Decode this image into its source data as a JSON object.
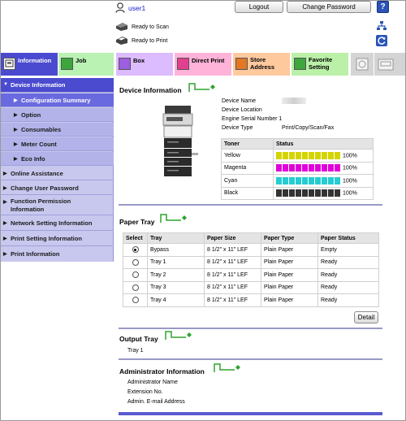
{
  "header": {
    "user": "user1",
    "logout": "Logout",
    "change_password": "Change Password",
    "help": "?",
    "status_scan": "Ready to Scan",
    "status_print": "Ready to Print"
  },
  "tabs": [
    {
      "label": "Information",
      "icon": "info-icon",
      "color": "#4a4ad0"
    },
    {
      "label": "Job",
      "icon": "job-icon",
      "color": "#b9f2b2"
    },
    {
      "label": "Box",
      "icon": "box-icon",
      "color": "#ddbbff"
    },
    {
      "label": "Direct Print",
      "icon": "direct-print-icon",
      "color": "#ffb3d9"
    },
    {
      "label": "Store\nAddress",
      "icon": "store-address-icon",
      "color": "#ffc99e"
    },
    {
      "label": "Favorite\nSetting",
      "icon": "favorite-icon",
      "color": "#bbf0a8"
    }
  ],
  "sidebar": {
    "items": [
      {
        "label": "Device Information"
      },
      {
        "label": "Configuration Summary"
      },
      {
        "label": "Option"
      },
      {
        "label": "Consumables"
      },
      {
        "label": "Meter Count"
      },
      {
        "label": "Eco Info"
      },
      {
        "label": "Online Assistance"
      },
      {
        "label": "Change User Password"
      },
      {
        "label": "Function Permission\nInformation"
      },
      {
        "label": "Network Setting Information"
      },
      {
        "label": "Print Setting Information"
      },
      {
        "label": "Print Information"
      }
    ]
  },
  "device": {
    "title": "Device Information",
    "name_label": "Device Name",
    "location_label": "Device Location",
    "serial_label": "Engine Serial Number 1",
    "type_label": "Device Type",
    "type_value": "Print/Copy/Scan/Fax"
  },
  "toner": {
    "col_toner": "Toner",
    "col_status": "Status",
    "rows": [
      {
        "name": "Yellow",
        "level": "100%",
        "color": "#d4d400"
      },
      {
        "name": "Magenta",
        "level": "100%",
        "color": "#e000d8"
      },
      {
        "name": "Cyan",
        "level": "100%",
        "color": "#25cdd2"
      },
      {
        "name": "Black",
        "level": "100%",
        "color": "#333333"
      }
    ]
  },
  "paper_tray": {
    "title": "Paper Tray",
    "headers": [
      "Select",
      "Tray",
      "Paper Size",
      "Paper Type",
      "Paper Status"
    ],
    "rows": [
      {
        "tray": "Bypass",
        "size": "8 1/2\" x 11\" LEF",
        "type": "Plain Paper",
        "status": "Empty",
        "selected": true
      },
      {
        "tray": "Tray 1",
        "size": "8 1/2\" x 11\" LEF",
        "type": "Plain Paper",
        "status": "Ready",
        "selected": false
      },
      {
        "tray": "Tray 2",
        "size": "8 1/2\" x 11\" LEF",
        "type": "Plain Paper",
        "status": "Ready",
        "selected": false
      },
      {
        "tray": "Tray 3",
        "size": "8 1/2\" x 11\" LEF",
        "type": "Plain Paper",
        "status": "Ready",
        "selected": false
      },
      {
        "tray": "Tray 4",
        "size": "8 1/2\" x 11\" LEF",
        "type": "Plain Paper",
        "status": "Ready",
        "selected": false
      }
    ],
    "detail": "Detail"
  },
  "output_tray": {
    "title": "Output Tray",
    "value": "Tray 1"
  },
  "admin": {
    "title": "Administrator Information",
    "name_label": "Administrator Name",
    "ext_label": "Extension No.",
    "email_label": "Admin. E-mail Address"
  }
}
